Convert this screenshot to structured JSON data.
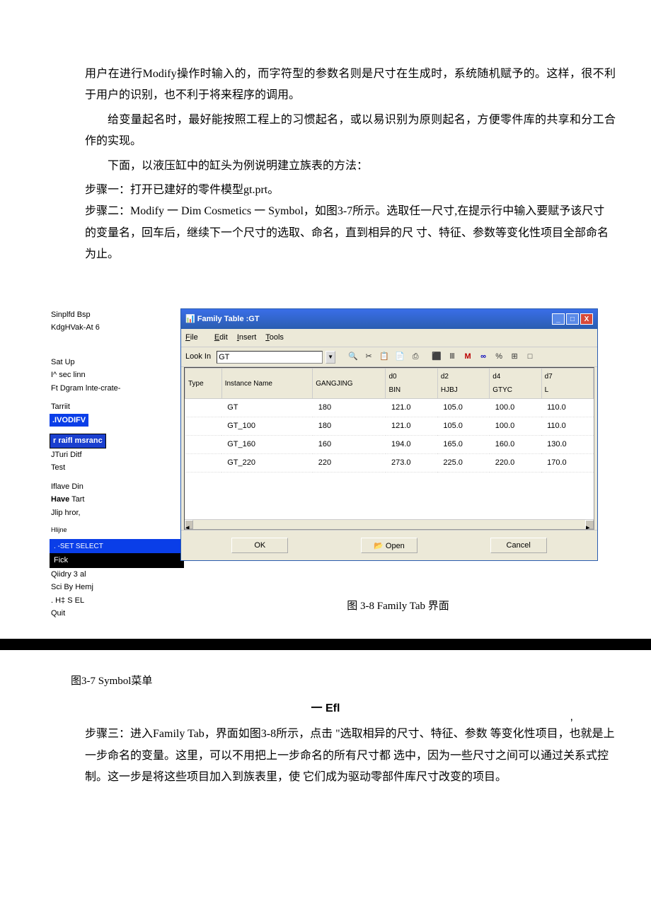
{
  "paras": {
    "p1": "用户在进行Modify操作时输入的，而字符型的参数名则是尺寸在生成时，系统随机赋予的。这样，很不利于用户的识别，也不利于将来程序的调用。",
    "p2": "给变量起名时，最好能按照工程上的习惯起名，或以易识别为原则起名，方便零件库的共享和分工合作的实现。",
    "p3": "下面，以液压缸中的缸头为例说明建立族表的方法：",
    "step1": "步骤一：打开已建好的零件模型gt.prt。",
    "step2": "步骤二：Modify 一 Dim Cosmetics 一 Symbol，如图3-7所示。选取任一尺寸,在提示行中输入要赋予该尺寸的变量名，回车后，继续下一个尺寸的选取、命名，直到相异的尺 寸、特征、参数等变化性项目全部命名为止。",
    "step3": "步骤三：进入Family Tab，界面如图3-8所示，点击 \"选取相异的尺寸、特征、参数 等变化性项目，也就是上一步命名的变量。这里，可以不用把上一步命名的所有尺寸都 选中，因为一些尺寸之间可以通过关系式控制。这一步是将这些项目加入到族表里，使 它们成为驱动零部件库尺寸改变的项目。"
  },
  "menu": {
    "l1": "Sinplfd Bsp",
    "l2": "KdgHVak-At 6",
    "l3": "Sat Up",
    "l4": "I^ sec linn",
    "l5": "Ft Dgram lnte-crate-",
    "l6": "Tarriit",
    "l7": ".IVODIFV",
    "l8": "r raifl msranc",
    "l9": "JTuri Ditf",
    "l10": "Test",
    "l11": "Iflave Din",
    "l12": "Have",
    "l12b": "Tart",
    "l13": "Jlip hror,",
    "l14": "Hlijne",
    "l15": ". -SET SELECT",
    "l16": "Fick",
    "l17": "Qiidry 3 al",
    "l18": "Sci By Hemj",
    "l19": ". H‡ S EL",
    "l20": "Quit"
  },
  "ft": {
    "title": "Family Table :GT",
    "menu_file": "File",
    "menu_edit": "Edit",
    "menu_insert": "Insert",
    "menu_tools": "Tools",
    "lookin_label": "Look In",
    "lookin_value": "GT",
    "columns": [
      "Type",
      "Instance Name",
      "GANGJING",
      "d0\nBIN",
      "d2\nHJBJ",
      "d4\nGTYC",
      "d7\nL"
    ],
    "rows": [
      {
        "inst": "GT",
        "v": [
          "180",
          "121.0",
          "105.0",
          "100.0",
          "110.0"
        ]
      },
      {
        "inst": "GT_100",
        "v": [
          "180",
          "121.0",
          "105.0",
          "100.0",
          "110.0"
        ]
      },
      {
        "inst": "GT_160",
        "v": [
          "160",
          "194.0",
          "165.0",
          "160.0",
          "130.0"
        ]
      },
      {
        "inst": "GT_220",
        "v": [
          "220",
          "273.0",
          "225.0",
          "220.0",
          "170.0"
        ]
      }
    ],
    "btn_ok": "OK",
    "btn_open": "📂 Open",
    "btn_cancel": "Cancel"
  },
  "captions": {
    "fig38": "图 3-8 Family Tab 界面",
    "fig37": "图3-7 Symbol菜单",
    "efl": "一 Efl",
    "efl_mark": ","
  }
}
